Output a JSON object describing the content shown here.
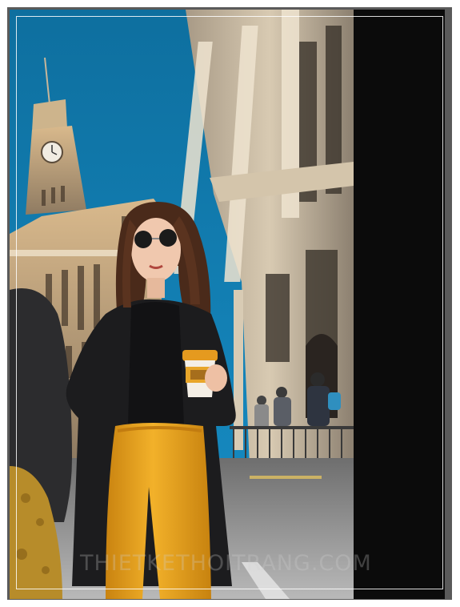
{
  "image": {
    "description_free": true,
    "watermark": "THIETKETHOITRANG.COM",
    "colors": {
      "sky": "#0f78ad",
      "building_stone": "#c9b69a",
      "pants_mustard": "#e8a21c",
      "jacket_black": "#1d1d1f",
      "side_panel": "#0b0b0b",
      "frame": "#5a5a5a"
    }
  }
}
